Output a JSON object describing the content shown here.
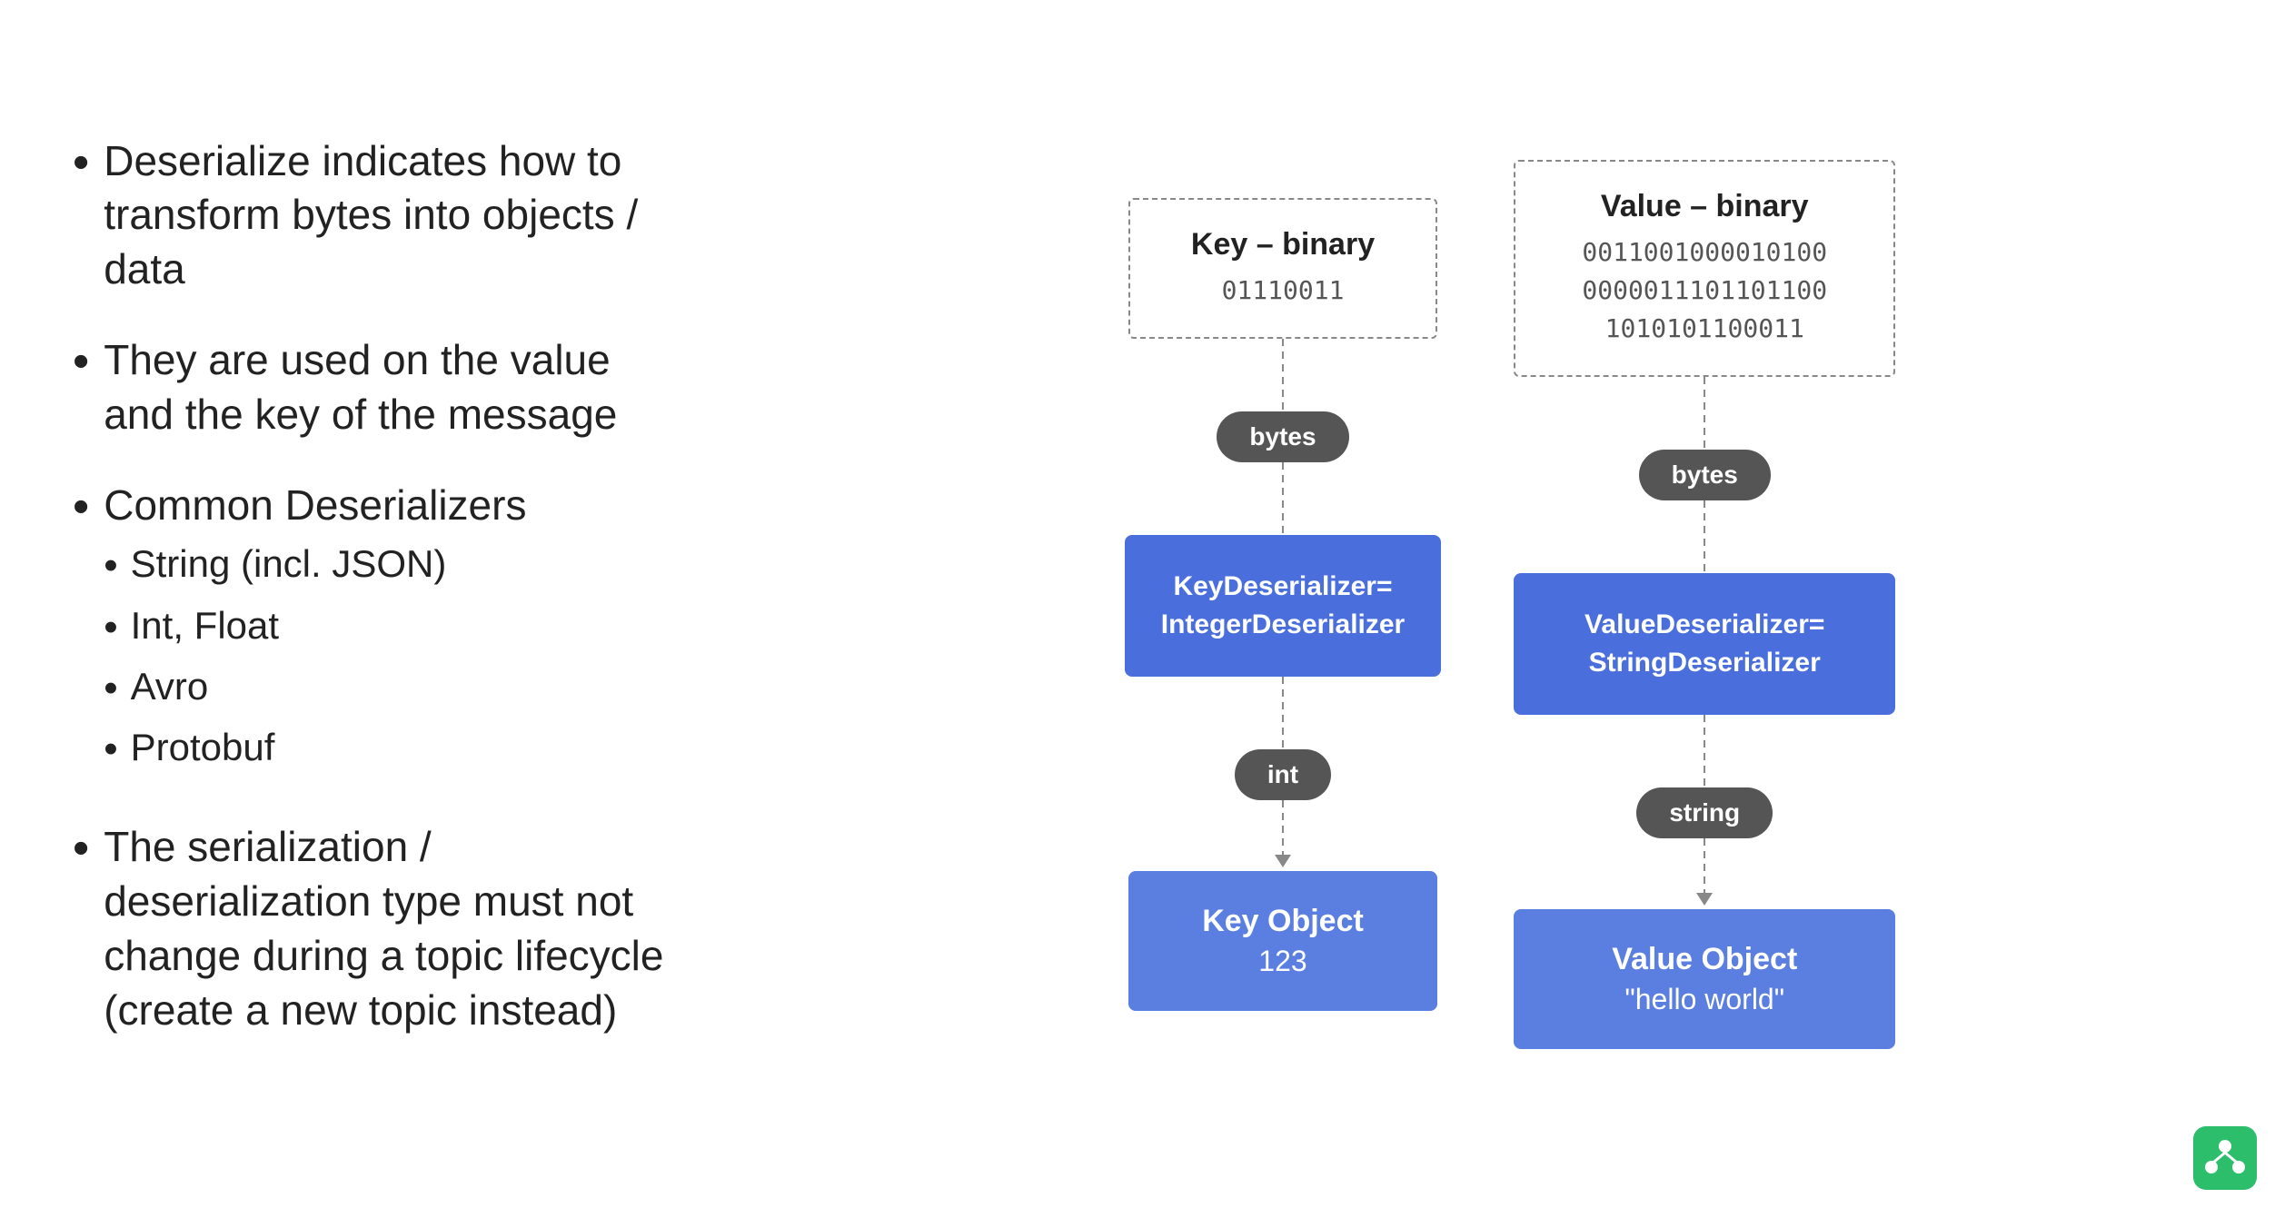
{
  "bullets": [
    {
      "text": "Deserialize indicates how to transform bytes into objects / data",
      "sub": []
    },
    {
      "text": "They are used on the value and the key of the message",
      "sub": []
    },
    {
      "text": "Common Deserializers",
      "sub": [
        "String (incl. JSON)",
        "Int, Float",
        "Avro",
        "Protobuf"
      ]
    },
    {
      "text": "The serialization / deserialization type must not change during a topic lifecycle (create a new topic instead)",
      "sub": []
    }
  ],
  "diagram": {
    "left": {
      "box_title": "Key – binary",
      "box_binary": "01110011",
      "pill1": "bytes",
      "deserializer": "KeyDeserializer=\nIntegerDeserializer",
      "pill2": "int",
      "obj_title": "Key Object",
      "obj_sub": "123"
    },
    "right": {
      "box_title": "Value – binary",
      "box_binary": "001100100001010000000111011011000\n1010101100011",
      "box_binary_line1": "0011001000010100",
      "box_binary_line2": "0000011101101100",
      "box_binary_line3": "1010101100011",
      "pill1": "bytes",
      "deserializer": "ValueDeserializer=\nStringDeserializer",
      "pill2": "string",
      "obj_title": "Value Object",
      "obj_sub": "\"hello world\""
    }
  },
  "icon": "kafka-icon"
}
